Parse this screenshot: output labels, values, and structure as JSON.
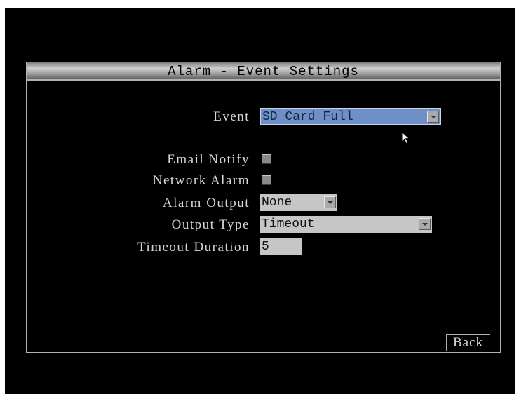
{
  "dialog": {
    "title": "Alarm - Event Settings"
  },
  "event": {
    "label": "Event",
    "value": "SD Card Full"
  },
  "email_notify": {
    "label": "Email Notify",
    "checked": false
  },
  "network_alarm": {
    "label": "Network Alarm",
    "checked": false
  },
  "alarm_output": {
    "label": "Alarm Output",
    "value": "None"
  },
  "output_type": {
    "label": "Output Type",
    "value": "Timeout"
  },
  "timeout_duration": {
    "label": "Timeout Duration",
    "value": "5"
  },
  "back_button": {
    "label": "Back"
  },
  "colors": {
    "background": "#000000",
    "selected_field": "#6f8fc7",
    "field": "#c6c6c6",
    "border": "#a9b4c3",
    "text": "#d6d6d6"
  }
}
